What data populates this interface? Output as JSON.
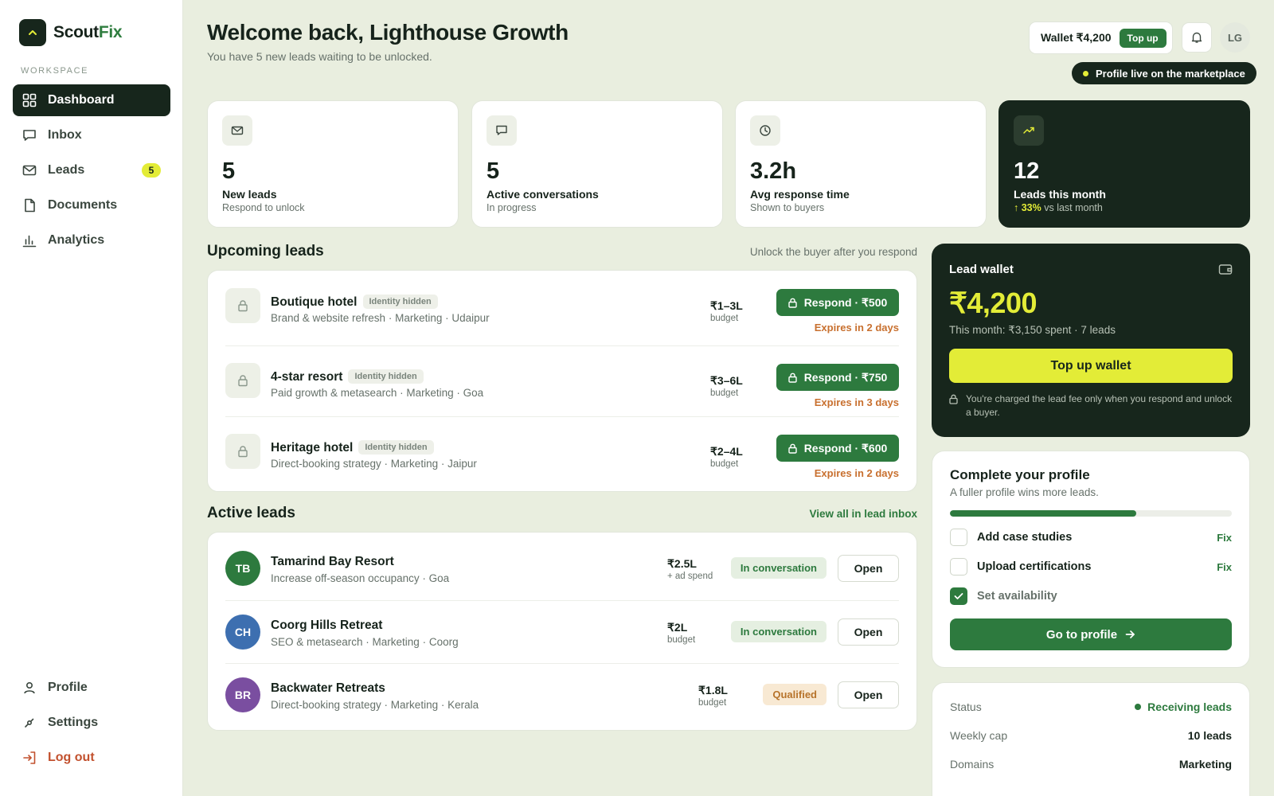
{
  "brand": {
    "name_prefix": "Scout",
    "name_accent": "Fix"
  },
  "sidebar": {
    "section_label": "WORKSPACE",
    "items": [
      {
        "label": "Dashboard",
        "icon": "grid-icon"
      },
      {
        "label": "Inbox",
        "icon": "chat-icon"
      },
      {
        "label": "Leads",
        "icon": "mail-icon",
        "badge": "5"
      },
      {
        "label": "Documents",
        "icon": "document-icon"
      },
      {
        "label": "Analytics",
        "icon": "bar-chart-icon"
      }
    ],
    "bottom": [
      {
        "label": "Profile",
        "icon": "user-icon"
      },
      {
        "label": "Settings",
        "icon": "settings-icon"
      },
      {
        "label": "Log out",
        "icon": "logout-icon"
      }
    ]
  },
  "header": {
    "title": "Welcome back, Lighthouse Growth",
    "subtitle": "You have 5 new leads waiting to be unlocked.",
    "wallet_label": "Wallet ₹4,200",
    "topup_label": "Top up",
    "avatar_initials": "LG",
    "live_status": "Profile live on the marketplace"
  },
  "stats": [
    {
      "value": "5",
      "label": "New leads",
      "sub": "Respond to unlock",
      "icon": "mail-icon"
    },
    {
      "value": "5",
      "label": "Active conversations",
      "sub": "In progress",
      "icon": "chat-icon"
    },
    {
      "value": "3.2h",
      "label": "Avg response time",
      "sub": "Shown to buyers",
      "icon": "clock-icon"
    },
    {
      "value": "12",
      "label": "Leads this month",
      "sub_up": "↑ 33%",
      "sub_rest": " vs last month",
      "icon": "trend-up-icon"
    }
  ],
  "upcoming": {
    "title": "Upcoming leads",
    "hint": "Unlock the buyer after you respond",
    "items": [
      {
        "title": "Boutique hotel",
        "chip": "Identity hidden",
        "sub": "Brand & website refresh · Marketing · Udaipur",
        "budget": "₹1–3L",
        "budget_label": "budget",
        "action": "Respond · ₹500",
        "expires": "Expires in 2 days"
      },
      {
        "title": "4-star resort",
        "chip": "Identity hidden",
        "sub": "Paid growth & metasearch · Marketing · Goa",
        "budget": "₹3–6L",
        "budget_label": "budget",
        "action": "Respond · ₹750",
        "expires": "Expires in 3 days"
      },
      {
        "title": "Heritage hotel",
        "chip": "Identity hidden",
        "sub": "Direct-booking strategy · Marketing · Jaipur",
        "budget": "₹2–4L",
        "budget_label": "budget",
        "action": "Respond · ₹600",
        "expires": "Expires in 2 days"
      }
    ]
  },
  "active": {
    "title": "Active leads",
    "link": "View all in lead inbox",
    "items": [
      {
        "initials": "TB",
        "color": "#2d7a3e",
        "title": "Tamarind Bay Resort",
        "sub": "Increase off-season occupancy · Goa",
        "budget": "₹2.5L",
        "budget_label": "+ ad spend",
        "status": "In conversation",
        "action": "Open"
      },
      {
        "initials": "CH",
        "color": "#3d6fb0",
        "title": "Coorg Hills Retreat",
        "sub": "SEO & metasearch · Marketing · Coorg",
        "budget": "₹2L",
        "budget_label": "budget",
        "status": "In conversation",
        "action": "Open"
      },
      {
        "initials": "BR",
        "color": "#7a4ea0",
        "title": "Backwater Retreats",
        "sub": "Direct-booking strategy · Marketing · Kerala",
        "budget": "₹1.8L",
        "budget_label": "budget",
        "status": "Qualified",
        "action": "Open"
      }
    ]
  },
  "wallet": {
    "title": "Lead wallet",
    "amount": "₹4,200",
    "sub": "This month: ₹3,150 spent · 7 leads",
    "button": "Top up wallet",
    "note": "You're charged the lead fee only when you respond and unlock a buyer."
  },
  "profile": {
    "title": "Complete your profile",
    "sub": "A fuller profile wins more leads.",
    "progress": 0.66,
    "tasks": [
      {
        "label": "Add case studies",
        "done": false,
        "action": "Fix"
      },
      {
        "label": "Upload certifications",
        "done": false,
        "action": "Fix"
      },
      {
        "label": "Set availability",
        "done": true
      }
    ],
    "button": "Go to profile"
  },
  "status": {
    "rows": [
      {
        "key": "Status",
        "value": "Receiving leads"
      },
      {
        "key": "Weekly cap",
        "value": "10 leads"
      },
      {
        "key": "Domains",
        "value": "Marketing"
      }
    ]
  },
  "colors": {
    "dark": "#17261c",
    "accent": "#2d7a3e",
    "lime": "#e3ec37",
    "warn": "#c8702f"
  }
}
